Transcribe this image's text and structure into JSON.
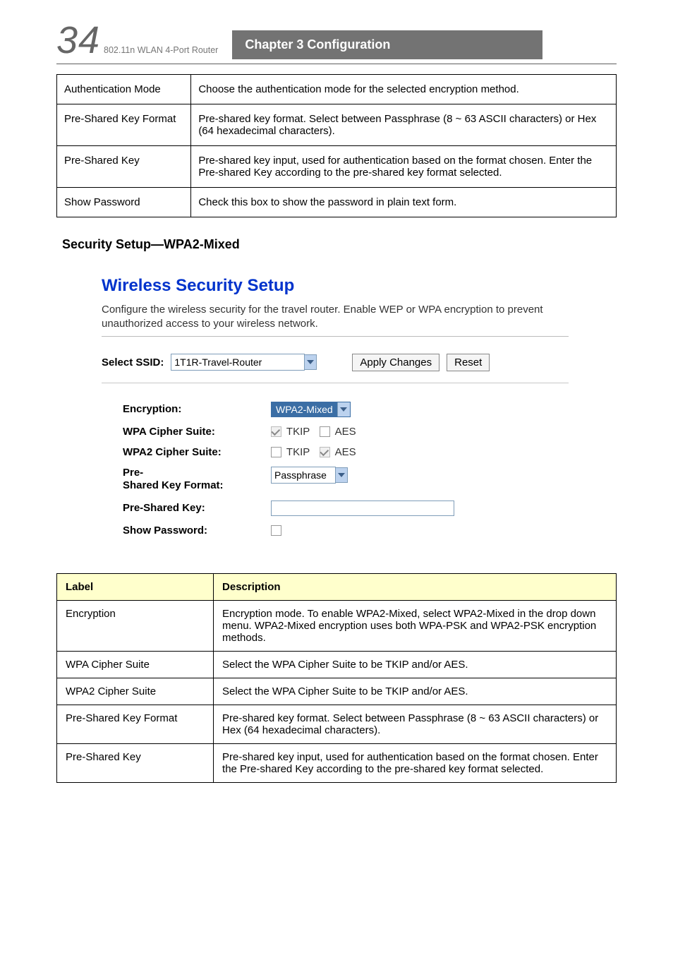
{
  "header": {
    "page_number": "34",
    "chapter": "Chapter 3 Configuration",
    "doc_ref": "802.11n WLAN 4-Port Router"
  },
  "top_table": {
    "rows": [
      {
        "c1": "Authentication Mode",
        "c2": "Choose the authentication mode for the selected encryption method."
      },
      {
        "c1": "Pre-Shared Key Format",
        "c2": "Pre-shared key format. Select between Passphrase (8 ~ 63 ASCII characters) or Hex (64 hexadecimal characters)."
      },
      {
        "c1": "Pre-Shared Key",
        "c2": "Pre-shared key input, used for authentication based on the format chosen. Enter the Pre-shared Key according to the pre-shared key format selected."
      },
      {
        "c1": "Show Password",
        "c2": "Check this box to show the password in plain text form."
      }
    ]
  },
  "section_heading": "Security Setup—WPA2-Mixed",
  "screenshot": {
    "title": "Wireless Security Setup",
    "description": "Configure the wireless security for the travel router. Enable WEP or WPA encryption to prevent unauthorized access to your wireless network.",
    "select_ssid_label": "Select SSID:",
    "select_ssid_value": "1T1R-Travel-Router",
    "apply_button": "Apply Changes",
    "reset_button": "Reset",
    "fields": {
      "encryption_label": "Encryption:",
      "encryption_value": "WPA2-Mixed",
      "wpa_cipher_label": "WPA Cipher Suite:",
      "wpa_cipher": {
        "tkip": {
          "label": "TKIP",
          "checked": true,
          "disabled": true
        },
        "aes": {
          "label": "AES",
          "checked": false,
          "disabled": false
        }
      },
      "wpa2_cipher_label": "WPA2 Cipher Suite:",
      "wpa2_cipher": {
        "tkip": {
          "label": "TKIP",
          "checked": false,
          "disabled": false
        },
        "aes": {
          "label": "AES",
          "checked": true,
          "disabled": true
        }
      },
      "psk_format_label": "Pre-\nShared Key Format:",
      "psk_format_value": "Passphrase",
      "psk_label": "Pre-Shared Key:",
      "psk_value": "",
      "show_pw_label": "Show Password:",
      "show_pw_checked": false
    }
  },
  "spec_table": {
    "headers": {
      "label": "Label",
      "desc": "Description"
    },
    "rows": [
      {
        "label": "Encryption",
        "desc": "Encryption mode. To enable WPA2-Mixed, select WPA2-Mixed in the drop down menu. WPA2-Mixed encryption uses both WPA-PSK and WPA2-PSK encryption methods."
      },
      {
        "label": "WPA Cipher Suite",
        "desc": "Select the WPA Cipher Suite to be TKIP and/or AES."
      },
      {
        "label": "WPA2 Cipher Suite",
        "desc": "Select the WPA Cipher Suite to be TKIP and/or AES."
      },
      {
        "label": "Pre-Shared Key Format",
        "desc": "Pre-shared key format. Select between Passphrase (8 ~ 63 ASCII characters) or Hex (64 hexadecimal characters)."
      },
      {
        "label": "Pre-Shared Key",
        "desc": "Pre-shared key input, used for authentication based on the format chosen. Enter the Pre-shared Key according to the pre-shared key format selected."
      }
    ]
  }
}
